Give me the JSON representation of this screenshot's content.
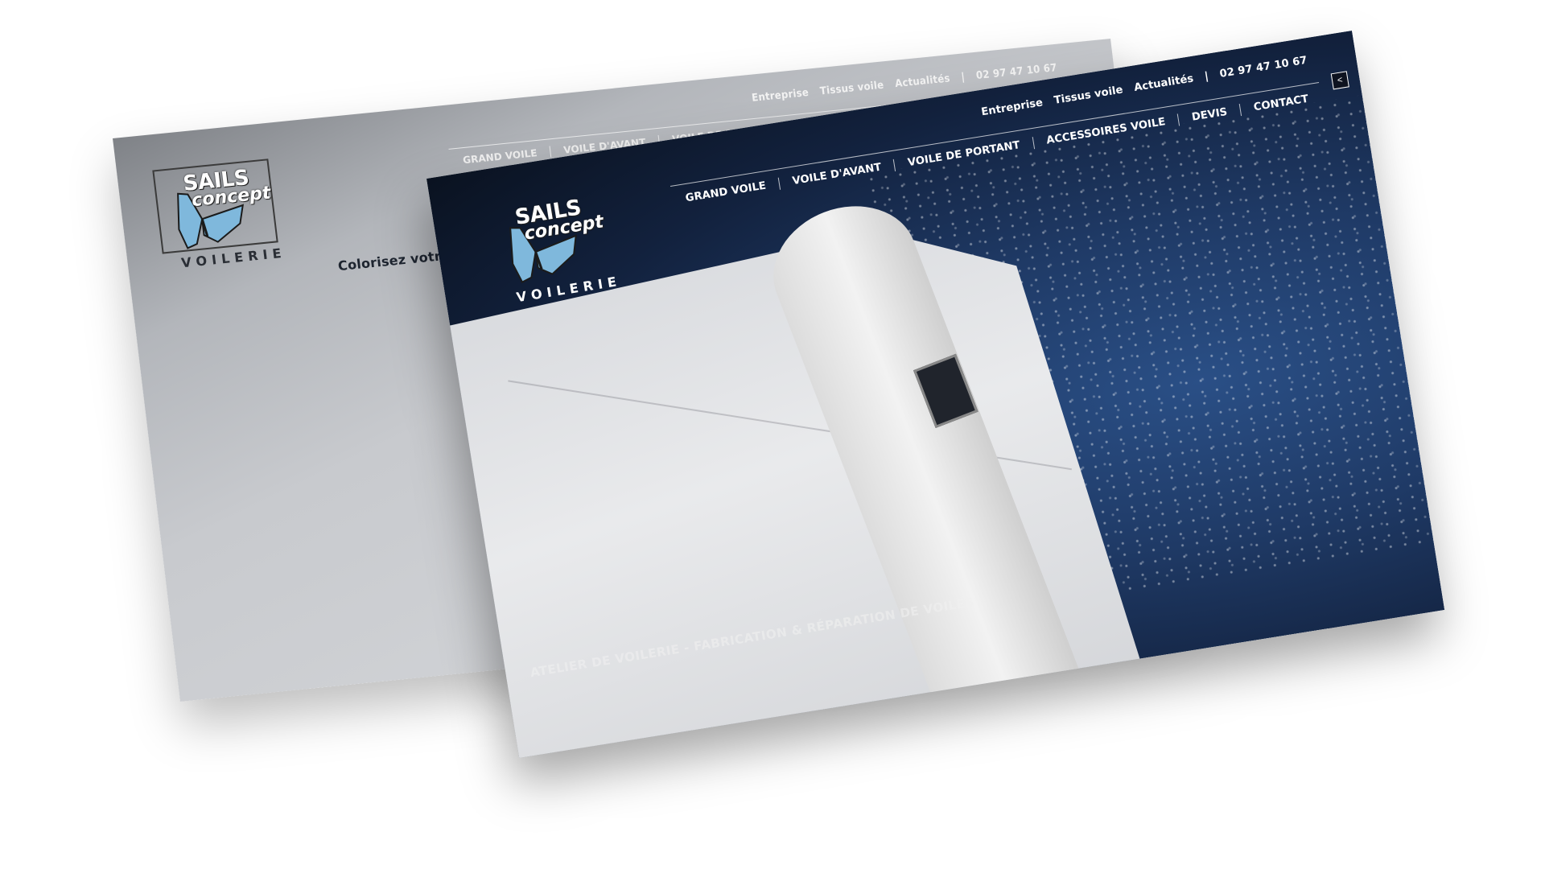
{
  "brand": {
    "line1": "SAILS",
    "line2": "concept",
    "sub": "VOILERIE",
    "butterfly_color": "#7fb8dc"
  },
  "top_links": [
    "Entreprise",
    "Tissus voile",
    "Actualités",
    "|",
    "02 97 47 10 67"
  ],
  "main_nav": [
    "GRAND VOILE",
    "VOILE D'AVANT",
    "VOILE DE PORTANT",
    "ACCESSOIRES VOILE",
    "DEVIS",
    "CONTACT"
  ],
  "share_icon": "share-icon",
  "back_page": {
    "tagline": "Colorisez votre vo"
  },
  "front_page": {
    "hero_text": "ATELIER DE VOILERIE - FABRICATION & RÉPARATION DE VOILES"
  },
  "colors": {
    "accent_blue": "#7fb8dc",
    "dark_navy": "#0a1220",
    "text_dark": "#1e2530"
  }
}
